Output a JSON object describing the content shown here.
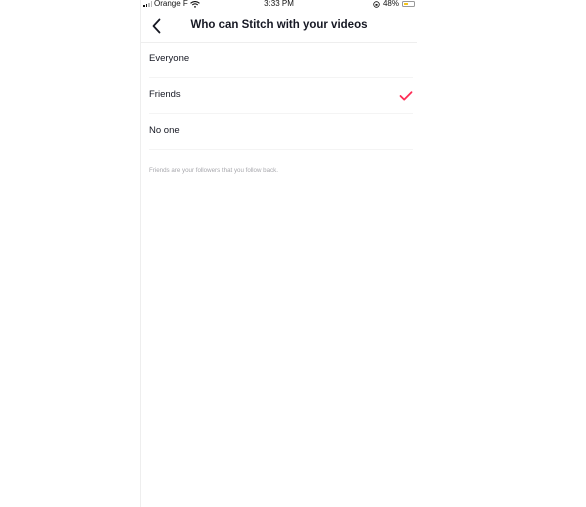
{
  "status_bar": {
    "carrier": "Orange F",
    "time": "3:33 PM",
    "battery_percent": "48%",
    "battery_level": 0.48,
    "icons": [
      "signal-icon",
      "wifi-icon",
      "orientation-lock-icon",
      "battery-icon"
    ]
  },
  "header": {
    "title": "Who can Stitch with your videos",
    "back_icon": "chevron-left-icon"
  },
  "options": [
    {
      "label": "Everyone",
      "selected": false
    },
    {
      "label": "Friends",
      "selected": true
    },
    {
      "label": "No one",
      "selected": false
    }
  ],
  "hint": "Friends are your followers that you follow back.",
  "colors": {
    "accent": "#fe2c55",
    "text": "#161823",
    "hint": "#a8a8ad",
    "battery": "#f5c518"
  }
}
